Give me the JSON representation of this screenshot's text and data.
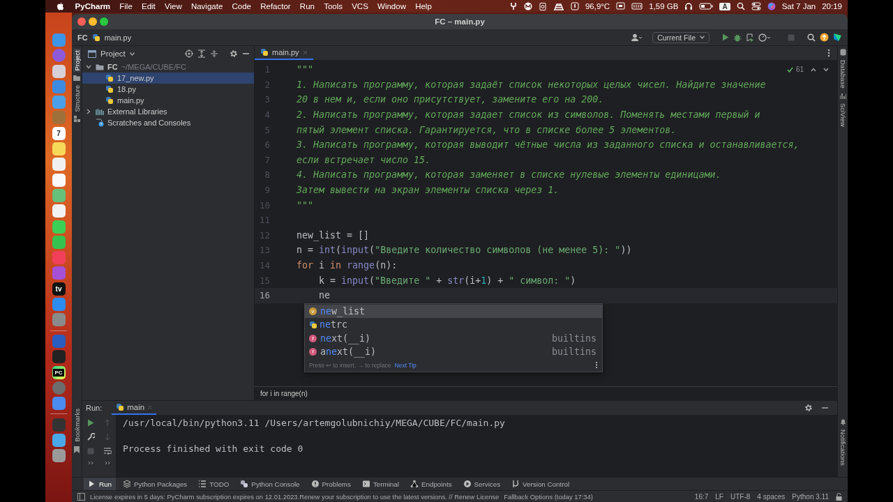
{
  "menubar": {
    "app": "PyCharm",
    "menus": [
      "File",
      "Edit",
      "View",
      "Navigate",
      "Code",
      "Refactor",
      "Run",
      "Tools",
      "VCS",
      "Window",
      "Help"
    ],
    "temperature": "96,9°C",
    "memory": "1,59 GB",
    "input_source": "A",
    "date": "Sat 7 Jan",
    "time": "20:19"
  },
  "dock": {
    "calendar_day": "7",
    "tv_label": "tv",
    "pycharm_label": "PC"
  },
  "window": {
    "title": "FC – main.py"
  },
  "navbar": {
    "breadcrumbs": [
      "FC",
      "main.py"
    ],
    "run_config": "Current File"
  },
  "tool_windows": {
    "left": [
      {
        "label": "Project",
        "selected": true
      },
      {
        "label": "Structure",
        "selected": false
      }
    ],
    "left_bottom": "Bookmarks",
    "right": [
      "Database",
      "SciView"
    ],
    "right_bottom": "Notifications"
  },
  "project": {
    "title": "Project",
    "tree": [
      {
        "name": "FC",
        "path": "~/MEGA/CUBE/FC",
        "kind": "folder",
        "expanded": true,
        "selected": false,
        "children": [
          {
            "name": "17_new.py",
            "kind": "python",
            "selected": true
          },
          {
            "name": "18.py",
            "kind": "python",
            "selected": false
          },
          {
            "name": "main.py",
            "kind": "python",
            "selected": false
          }
        ]
      },
      {
        "name": "External Libraries",
        "kind": "library",
        "expanded": false,
        "selected": false
      },
      {
        "name": "Scratches and Consoles",
        "kind": "scratch",
        "selected": false
      }
    ]
  },
  "editor": {
    "tabs": [
      {
        "label": "main.py",
        "selected": true
      }
    ],
    "inspections": "61",
    "lines": [
      {
        "number": "1",
        "current": false,
        "tokens": [
          {
            "kind": "doc",
            "text": "\"\"\""
          }
        ]
      },
      {
        "number": "2",
        "current": false,
        "tokens": [
          {
            "kind": "doc",
            "text": "1. Написать программу, которая задаёт список некоторых целых чисел. Найдите значение"
          }
        ]
      },
      {
        "number": "3",
        "current": false,
        "tokens": [
          {
            "kind": "doc",
            "text": "20 в нем и, если оно присутствует, замените его на 200."
          }
        ]
      },
      {
        "number": "4",
        "current": false,
        "tokens": [
          {
            "kind": "doc",
            "text": "2. Написать программу, которая задает список из символов. Поменять местами первый и"
          }
        ]
      },
      {
        "number": "5",
        "current": false,
        "tokens": [
          {
            "kind": "doc",
            "text": "пятый элемент списка. Гарантируется, что в списке более 5 элементов."
          }
        ]
      },
      {
        "number": "6",
        "current": false,
        "tokens": [
          {
            "kind": "doc",
            "text": "3. Написать программу, которая выводит чётные числа из заданного списка и останавливается,"
          }
        ]
      },
      {
        "number": "7",
        "current": false,
        "tokens": [
          {
            "kind": "doc",
            "text": "если встречает число 15."
          }
        ]
      },
      {
        "number": "8",
        "current": false,
        "tokens": [
          {
            "kind": "doc",
            "text": "4. Написать программу, которая заменяет в списке нулевые элементы единицами."
          }
        ]
      },
      {
        "number": "9",
        "current": false,
        "tokens": [
          {
            "kind": "doc",
            "text": "Затем вывести на экран элементы списка через 1."
          }
        ]
      },
      {
        "number": "10",
        "current": false,
        "tokens": [
          {
            "kind": "doc",
            "text": "\"\"\""
          }
        ]
      },
      {
        "number": "11",
        "current": false
      },
      {
        "number": "12",
        "current": false,
        "tokens": [
          {
            "kind": "plain",
            "text": "new_list = []"
          }
        ]
      },
      {
        "number": "13",
        "current": false,
        "tokens": [
          {
            "kind": "plain",
            "text": "n = "
          },
          {
            "kind": "builtin",
            "text": "int"
          },
          {
            "kind": "plain",
            "text": "("
          },
          {
            "kind": "builtin",
            "text": "input"
          },
          {
            "kind": "plain",
            "text": "("
          },
          {
            "kind": "string",
            "text": "\"Введите количество символов (не менее 5): \""
          },
          {
            "kind": "plain",
            "text": "))"
          }
        ]
      },
      {
        "number": "14",
        "current": false,
        "tokens": [
          {
            "kind": "keyword",
            "text": "for"
          },
          {
            "kind": "plain",
            "text": " i "
          },
          {
            "kind": "keyword",
            "text": "in"
          },
          {
            "kind": "builtin",
            "text": " range"
          },
          {
            "kind": "plain",
            "text": "(n):"
          }
        ]
      },
      {
        "number": "15",
        "current": false,
        "tokens": [
          {
            "kind": "plain",
            "text": "    k = "
          },
          {
            "kind": "builtin",
            "text": "input"
          },
          {
            "kind": "plain",
            "text": "("
          },
          {
            "kind": "string",
            "text": "\"Введите \""
          },
          {
            "kind": "plain",
            "text": " + "
          },
          {
            "kind": "builtin",
            "text": "str"
          },
          {
            "kind": "plain",
            "text": "(i+"
          },
          {
            "kind": "number",
            "text": "1"
          },
          {
            "kind": "plain",
            "text": ") + "
          },
          {
            "kind": "string",
            "text": "\" символ: \""
          },
          {
            "kind": "plain",
            "text": ")"
          }
        ]
      },
      {
        "number": "16",
        "current": true,
        "tokens": [
          {
            "kind": "plain",
            "text": "    ne"
          }
        ]
      }
    ],
    "completion": {
      "items": [
        {
          "kind": "variable",
          "badge": "v",
          "text": "**ne**w_list",
          "selected": true
        },
        {
          "kind": "module",
          "text": "**ne**trc",
          "selected": false
        },
        {
          "kind": "function",
          "badge": "f",
          "text": "**ne**xt(__i)",
          "source": "builtins",
          "selected": false
        },
        {
          "kind": "function",
          "badge": "f",
          "text": "a**ne**xt(__i)",
          "source": "builtins",
          "selected": false
        }
      ],
      "hint": "Press ↩ to insert, → to replace",
      "tip_link": "Next Tip"
    },
    "breadcrumb": "for i in range(n)"
  },
  "run": {
    "label": "Run:",
    "tabs": [
      {
        "label": "main",
        "selected": true
      }
    ],
    "output": [
      "/usr/local/bin/python3.11 /Users/artemgolubnichiy/MEGA/CUBE/FC/main.py",
      "Process finished with exit code 0"
    ]
  },
  "tool_bar": [
    {
      "kind": "run",
      "label": "Run",
      "selected": true
    },
    {
      "kind": "packages",
      "label": "Python Packages",
      "selected": false
    },
    {
      "kind": "todo",
      "label": "TODO",
      "selected": false
    },
    {
      "kind": "console",
      "label": "Python Console",
      "selected": false
    },
    {
      "kind": "problems",
      "label": "Problems",
      "selected": false
    },
    {
      "kind": "terminal",
      "label": "Terminal",
      "selected": false
    },
    {
      "kind": "endpoints",
      "label": "Endpoints",
      "selected": false
    },
    {
      "kind": "services",
      "label": "Services",
      "selected": false
    },
    {
      "kind": "vcs",
      "label": "Version Control",
      "selected": false
    }
  ],
  "status_bar": {
    "message": "License expires in 5 days: PyCharm subscription expires on 12.01.2023.Renew your subscription to use the latest versions. // Renew License",
    "fallback": "Fallback Options (today 17:34)",
    "position": "16:7",
    "line_separator": "LF",
    "encoding": "UTF-8",
    "indent": "4 spaces",
    "interpreter": "Python 3.11"
  }
}
